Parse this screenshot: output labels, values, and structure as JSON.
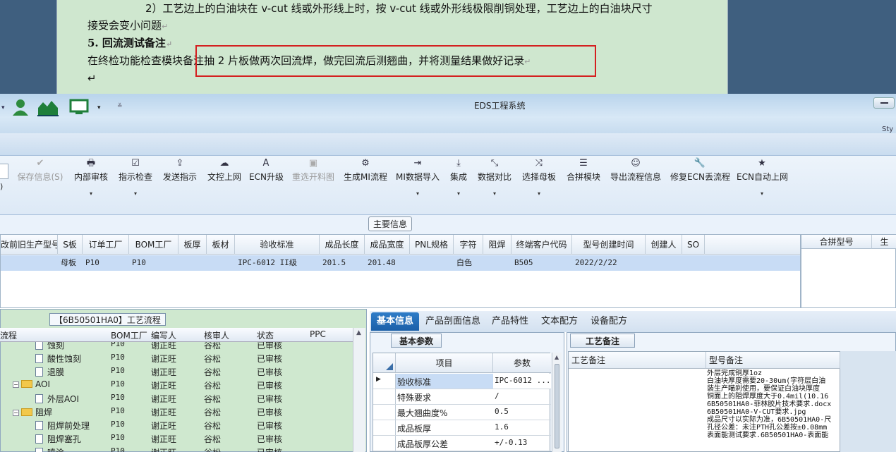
{
  "document": {
    "line1": "2）工艺边上的白油块在 v-cut 线或外形线上时，按 v-cut 线或外形线极限削铜处理，工艺边上的白油块尺寸",
    "line2": "接受会变小问题",
    "heading": "5. 回流测试备注",
    "line3": "在终检功能检查模块备注抽 2 片板做两次回流焊，做完回流后测翘曲，并将测量结果做好记录",
    "paragraph_mark": "↵"
  },
  "window": {
    "title": "EDS工程系统",
    "right_cut": "Sty"
  },
  "ribbon": {
    "buttons": [
      {
        "label": "保存信息(S)",
        "icon": "✔",
        "disabled": true,
        "dropdown": false
      },
      {
        "label": "内部审核",
        "icon": "🖶",
        "disabled": false,
        "dropdown": true
      },
      {
        "label": "指示检查",
        "icon": "☑",
        "disabled": false,
        "dropdown": true
      },
      {
        "label": "发送指示",
        "icon": "⇪",
        "disabled": false,
        "dropdown": false
      },
      {
        "label": "文控上网",
        "icon": "☁",
        "disabled": false,
        "dropdown": false
      },
      {
        "label": "ECN升级",
        "icon": "A",
        "disabled": false,
        "dropdown": false
      },
      {
        "label": "重选开料图",
        "icon": "▣",
        "disabled": true,
        "dropdown": false
      },
      {
        "label": "生成MI流程",
        "icon": "⚙",
        "disabled": false,
        "dropdown": false
      },
      {
        "label": "MI数据导入",
        "icon": "⇥",
        "disabled": false,
        "dropdown": true
      },
      {
        "label": "集成",
        "icon": "⤓",
        "disabled": false,
        "dropdown": true
      },
      {
        "label": "数据对比",
        "icon": "⤡",
        "disabled": false,
        "dropdown": true
      },
      {
        "label": "选择母板",
        "icon": "⤨",
        "disabled": false,
        "dropdown": true
      },
      {
        "label": "合拼模块",
        "icon": "☰",
        "disabled": false,
        "dropdown": false
      },
      {
        "label": "导出流程信息",
        "icon": "☺",
        "disabled": false,
        "dropdown": false
      },
      {
        "label": "修复ECN丢流程",
        "icon": "🔧",
        "disabled": false,
        "dropdown": false
      },
      {
        "label": "ECN自动上网",
        "icon": "★",
        "disabled": false,
        "dropdown": true
      }
    ]
  },
  "main_info": {
    "section_label": "主要信息",
    "columns": [
      "改前旧生产型号",
      "S板",
      "订单工厂",
      "BOM工厂",
      "板厚",
      "板材",
      "验收标准",
      "成品长度",
      "成品宽度",
      "PNL规格",
      "字符",
      "阻焊",
      "终端客户代码",
      "型号创建时间",
      "创建人",
      "SO"
    ],
    "row": [
      "",
      "母板",
      "P10",
      "P10",
      "",
      "",
      "IPC-6012 II级",
      "201.5",
      "201.48",
      "",
      "白色",
      "",
      "B505",
      "2022/2/22",
      "",
      ""
    ],
    "side_header": "合拼型号",
    "side_header2": "生"
  },
  "process": {
    "title": "【6B50501HA0】工艺流程",
    "columns": [
      "流程",
      "BOM工厂",
      "编写人",
      "核审人",
      "状态",
      "PPC"
    ],
    "rows": [
      {
        "name": "蚀刻",
        "type": "page",
        "bom": "P10",
        "writer": "谢正旺",
        "reviewer": "谷松",
        "status": "已审核"
      },
      {
        "name": "酸性蚀刻",
        "type": "page",
        "bom": "P10",
        "writer": "谢正旺",
        "reviewer": "谷松",
        "status": "已审核"
      },
      {
        "name": "退膜",
        "type": "page",
        "bom": "P10",
        "writer": "谢正旺",
        "reviewer": "谷松",
        "status": "已审核"
      },
      {
        "name": "AOI",
        "type": "folder",
        "bom": "P10",
        "writer": "谢正旺",
        "reviewer": "谷松",
        "status": "已审核"
      },
      {
        "name": "外层AOI",
        "type": "page",
        "bom": "P10",
        "writer": "谢正旺",
        "reviewer": "谷松",
        "status": "已审核"
      },
      {
        "name": "阻焊",
        "type": "folder",
        "bom": "P10",
        "writer": "谢正旺",
        "reviewer": "谷松",
        "status": "已审核"
      },
      {
        "name": "阻焊前处理",
        "type": "page",
        "bom": "P10",
        "writer": "谢正旺",
        "reviewer": "谷松",
        "status": "已审核"
      },
      {
        "name": "阻焊塞孔",
        "type": "page",
        "bom": "P10",
        "writer": "谢正旺",
        "reviewer": "谷松",
        "status": "已审核"
      },
      {
        "name": "喷涂",
        "type": "page",
        "bom": "P10",
        "writer": "谢正旺",
        "reviewer": "谷松",
        "status": "已审核"
      }
    ]
  },
  "middle_tabs": [
    "基本信息",
    "产品剖面信息",
    "产品特性",
    "文本配方",
    "设备配方"
  ],
  "basic_params": {
    "title": "基本参数",
    "columns": [
      "项目",
      "参数"
    ],
    "rows": [
      {
        "item": "验收标准",
        "value": "IPC-6012 ..."
      },
      {
        "item": "特殊要求",
        "value": "/"
      },
      {
        "item": "最大翘曲度%",
        "value": "0.5"
      },
      {
        "item": "成品板厚",
        "value": "1.6"
      },
      {
        "item": "成品板厚公差",
        "value": "+/-0.13"
      }
    ]
  },
  "process_notes": {
    "title": "工艺备注",
    "columns": [
      "工艺备注",
      "型号备注"
    ],
    "lines": [
      "外层完成铜厚1oz",
      "白油块厚度需要20-30um(字符层白油",
      "装生产瞄刹使用，要保证白油块厚度",
      "铜面上的阻焊厚度大于0.4mil(10.16",
      "6B50501HA0-菲林胶片技术要求.docx",
      "6B50501HA0-V-CUT要求.jpg",
      "成品尺寸以实际为准，6B50501HA0-尺",
      "孔径公差：未注PTH孔公差按±0.08mm",
      "表面能测试要求.6B50501HA0-表面能"
    ]
  }
}
